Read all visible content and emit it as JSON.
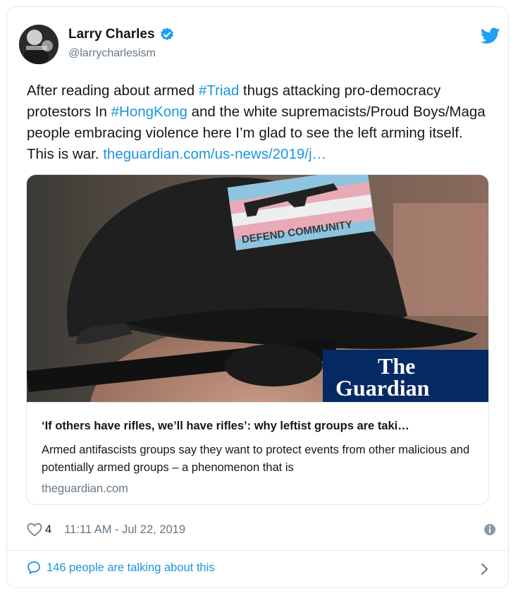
{
  "tweet": {
    "author_name": "Larry Charles",
    "handle": "@larrycharlesism",
    "text_parts": {
      "p1": "After reading about armed ",
      "tag1": "#Triad",
      "p2": " thugs attacking pro-democracy protestors In ",
      "tag2": "#HongKong",
      "p3": " and the white supremacists/Proud Boys/Maga people embracing violence here I’m glad to see the left arming itself. This is war. ",
      "link": "theguardian.com/us-news/2019/j…"
    },
    "likes": "4",
    "timestamp": "11:11 AM - Jul 22, 2019",
    "talking": "146 people are talking about this"
  },
  "link_card": {
    "image_patch_text": "DEFEND COMMUNITY",
    "logo_line1": "The",
    "logo_line2": "Guardian",
    "title": "‘If others have rifles, we’ll have rifles’: why leftist groups are taki…",
    "description": "Armed antifascists groups say they want to protect events from other malicious and potentially armed groups – a phenomenon that is",
    "domain": "theguardian.com"
  },
  "colors": {
    "link": "#1b95e0",
    "secondary_text": "#657786",
    "guardian_blue": "#052962",
    "border": "#e1e8ed"
  },
  "icons": [
    "avatar",
    "verified-badge-icon",
    "twitter-bird-icon",
    "heart-icon",
    "info-icon",
    "speech-bubble-icon",
    "chevron-right-icon"
  ]
}
